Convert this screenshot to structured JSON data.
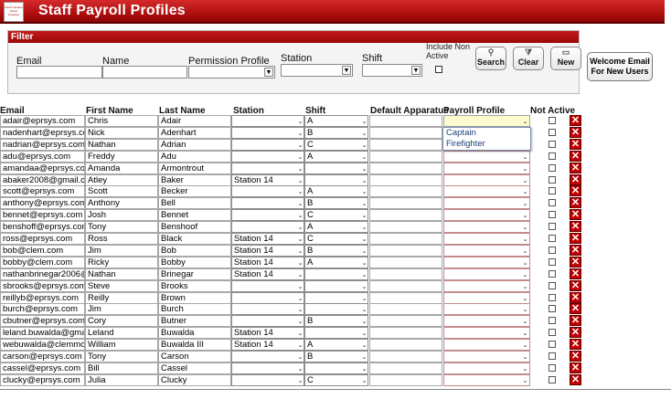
{
  "app": {
    "title": "Staff Payroll Profiles",
    "logo_text": "North Carolina Rural Volunteer"
  },
  "colors": {
    "brand": "#b01010",
    "delete": "#c00000",
    "row_highlight": "#fdfcd0"
  },
  "filter": {
    "heading": "Filter",
    "email_label": "Email",
    "name_label": "Name",
    "permission_label": "Permission Profile",
    "station_label": "Station",
    "shift_label": "Shift",
    "include_non_active_label": "Include Non Active",
    "search_label": "Search",
    "clear_label": "Clear",
    "new_label": "New",
    "welcome_label": "Welcome Email For New Users"
  },
  "grid": {
    "columns": [
      "Email",
      "First Name",
      "Last Name",
      "Station",
      "Shift",
      "Default Apparatus",
      "Payroll Profile",
      "Not Active"
    ],
    "rows": [
      {
        "email": "adair@eprsys.com",
        "first": "Chris",
        "last": "Adair",
        "station": "",
        "shift": "A"
      },
      {
        "email": "nadenhart@eprsys.co",
        "first": "Nick",
        "last": "Adenhart",
        "station": "",
        "shift": "B"
      },
      {
        "email": "nadrian@eprsys.com",
        "first": "Nathan",
        "last": "Adrian",
        "station": "",
        "shift": "C"
      },
      {
        "email": "adu@eprsys.com",
        "first": "Freddy",
        "last": "Adu",
        "station": "",
        "shift": "A"
      },
      {
        "email": "amandaa@eprsys.com",
        "first": "Amanda",
        "last": "Armontrout",
        "station": "",
        "shift": ""
      },
      {
        "email": "abaker2008@gmail.co",
        "first": "Atley",
        "last": "Baker",
        "station": "Station 14",
        "shift": ""
      },
      {
        "email": "scott@eprsys.com",
        "first": "Scott",
        "last": "Becker",
        "station": "",
        "shift": "A"
      },
      {
        "email": "anthony@eprsys.com",
        "first": "Anthony",
        "last": "Bell",
        "station": "",
        "shift": "B"
      },
      {
        "email": "bennet@eprsys.com",
        "first": "Josh",
        "last": "Bennet",
        "station": "",
        "shift": "C"
      },
      {
        "email": "benshoff@eprsys.com",
        "first": "Tony",
        "last": "Benshoof",
        "station": "",
        "shift": "A"
      },
      {
        "email": "ross@eprsys.com",
        "first": "Ross",
        "last": "Black",
        "station": "Station 14",
        "shift": "C"
      },
      {
        "email": "bob@clem.com",
        "first": "Jim",
        "last": "Bob",
        "station": "Station 14",
        "shift": "B"
      },
      {
        "email": "bobby@clem.com",
        "first": "Ricky",
        "last": "Bobby",
        "station": "Station 14",
        "shift": "A"
      },
      {
        "email": "nathanbrinegar2006@",
        "first": "Nathan",
        "last": "Brinegar",
        "station": "Station 14",
        "shift": ""
      },
      {
        "email": "sbrooks@eprsys.com",
        "first": "Steve",
        "last": "Brooks",
        "station": "",
        "shift": ""
      },
      {
        "email": "reillyb@eprsys.com",
        "first": "Reilly",
        "last": "Brown",
        "station": "",
        "shift": ""
      },
      {
        "email": "burch@eprsys.com",
        "first": "Jim",
        "last": "Burch",
        "station": "",
        "shift": ""
      },
      {
        "email": "cbutner@eprsys.com",
        "first": "Cory",
        "last": "Butner",
        "station": "",
        "shift": "B"
      },
      {
        "email": "leland.buwalda@gma",
        "first": "Leland",
        "last": "Buwalda",
        "station": "Station 14",
        "shift": ""
      },
      {
        "email": "webuwalda@clemmo",
        "first": "William",
        "last": "Buwalda III",
        "station": "Station 14",
        "shift": "A"
      },
      {
        "email": "carson@eprsys.com",
        "first": "Tony",
        "last": "Carson",
        "station": "",
        "shift": "B"
      },
      {
        "email": "cassel@eprsys.com",
        "first": "Bill",
        "last": "Cassel",
        "station": "",
        "shift": ""
      },
      {
        "email": "clucky@eprsys.com",
        "first": "Julia",
        "last": "Clucky",
        "station": "",
        "shift": "C"
      }
    ]
  },
  "payroll_dropdown": {
    "options": [
      "Captain",
      "Firefighter"
    ]
  }
}
